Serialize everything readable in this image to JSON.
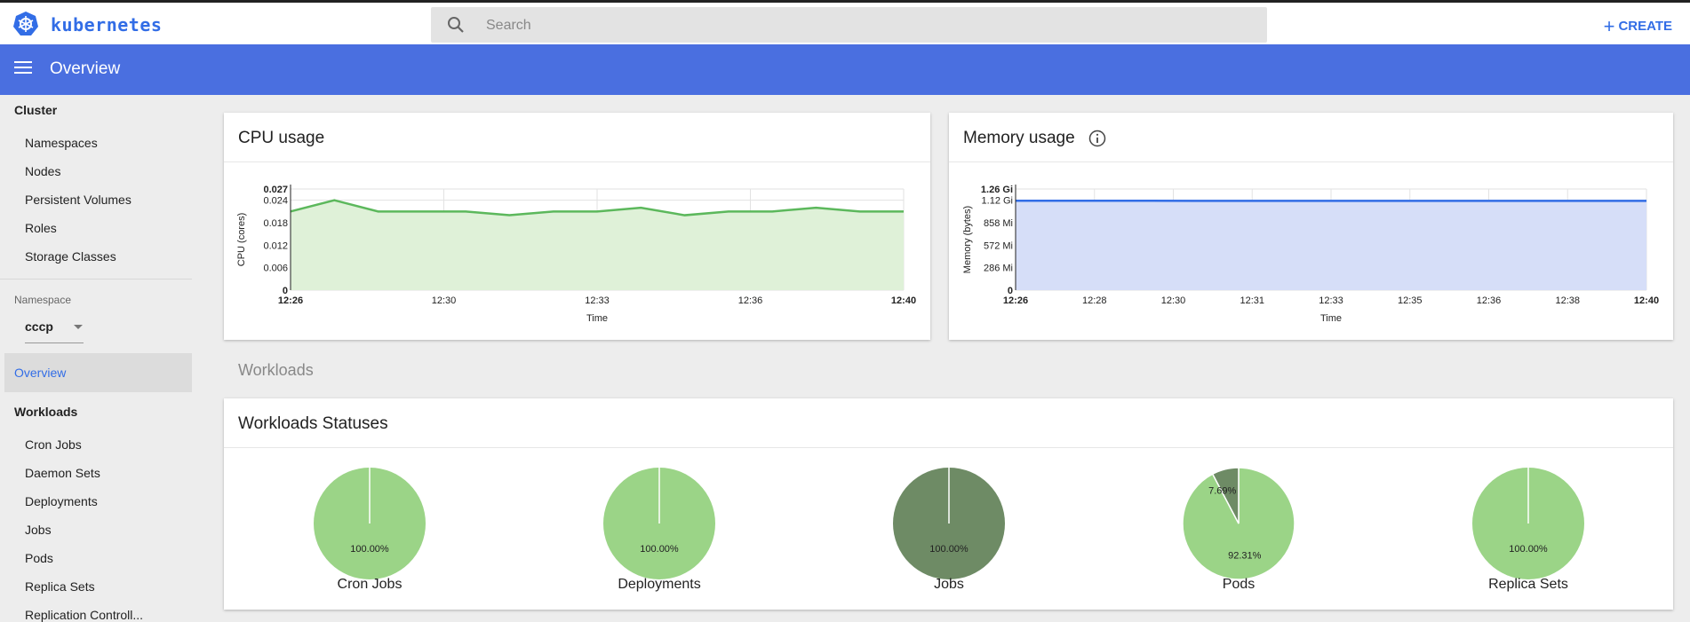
{
  "app": {
    "brand": "kubernetes"
  },
  "search": {
    "placeholder": "Search"
  },
  "toolbar": {
    "create_label": "CREATE"
  },
  "header": {
    "title": "Overview"
  },
  "sidebar": {
    "cluster_heading": "Cluster",
    "cluster_items": [
      "Namespaces",
      "Nodes",
      "Persistent Volumes",
      "Roles",
      "Storage Classes"
    ],
    "namespace_label": "Namespace",
    "namespace_value": "cccp",
    "overview": "Overview",
    "workloads_heading": "Workloads",
    "workload_items": [
      "Cron Jobs",
      "Daemon Sets",
      "Deployments",
      "Jobs",
      "Pods",
      "Replica Sets",
      "Replication Controll..."
    ]
  },
  "workloads_section": "Workloads",
  "colors": {
    "accent": "#326de6",
    "header": "#4a6fe0",
    "cpu": "#5cb85c",
    "memory": "#326de6",
    "pie_ok": "#9bd487",
    "pie_dark": "#6e8b65"
  },
  "chart_data": [
    {
      "type": "area",
      "title": "CPU usage",
      "xlabel": "Time",
      "ylabel": "CPU (cores)",
      "ylim": [
        0,
        0.027
      ],
      "yticks": [
        "0",
        "0.006",
        "0.012",
        "0.018",
        "0.024",
        "0.027"
      ],
      "x_ticks": [
        "12:26",
        "12:30",
        "12:33",
        "12:36",
        "12:40"
      ],
      "series": [
        {
          "values": [
            0.021,
            0.024,
            0.021,
            0.021,
            0.021,
            0.02,
            0.021,
            0.021,
            0.022,
            0.02,
            0.021,
            0.021,
            0.022,
            0.021,
            0.021
          ]
        }
      ],
      "grid": true
    },
    {
      "type": "area",
      "title": "Memory usage",
      "xlabel": "Time",
      "ylabel": "Memory (bytes)",
      "yticks": [
        "0",
        "286 Mi",
        "572 Mi",
        "858 Mi",
        "1.12 Gi",
        "1.26 Gi"
      ],
      "ytick_values_mi": [
        0,
        286,
        572,
        858,
        1147,
        1290
      ],
      "x_ticks": [
        "12:26",
        "12:28",
        "12:30",
        "12:31",
        "12:33",
        "12:35",
        "12:36",
        "12:38",
        "12:40"
      ],
      "series": [
        {
          "values_mi": [
            1140,
            1140,
            1140,
            1140,
            1139,
            1139,
            1139,
            1139,
            1138,
            1138,
            1138,
            1138,
            1138,
            1139,
            1139
          ]
        }
      ],
      "grid": true
    },
    {
      "type": "pie",
      "title": "Workloads Statuses",
      "pies": [
        {
          "name": "Cron Jobs",
          "slices": [
            {
              "value": 100.0,
              "label": "100.00%",
              "color": "#9bd487"
            }
          ]
        },
        {
          "name": "Deployments",
          "slices": [
            {
              "value": 100.0,
              "label": "100.00%",
              "color": "#9bd487"
            }
          ]
        },
        {
          "name": "Jobs",
          "slices": [
            {
              "value": 100.0,
              "label": "100.00%",
              "color": "#6e8b65"
            }
          ]
        },
        {
          "name": "Pods",
          "slices": [
            {
              "value": 92.31,
              "label": "92.31%",
              "color": "#9bd487"
            },
            {
              "value": 7.69,
              "label": "7.69%",
              "color": "#6e8b65"
            }
          ]
        },
        {
          "name": "Replica Sets",
          "slices": [
            {
              "value": 100.0,
              "label": "100.00%",
              "color": "#9bd487"
            }
          ]
        }
      ]
    }
  ]
}
